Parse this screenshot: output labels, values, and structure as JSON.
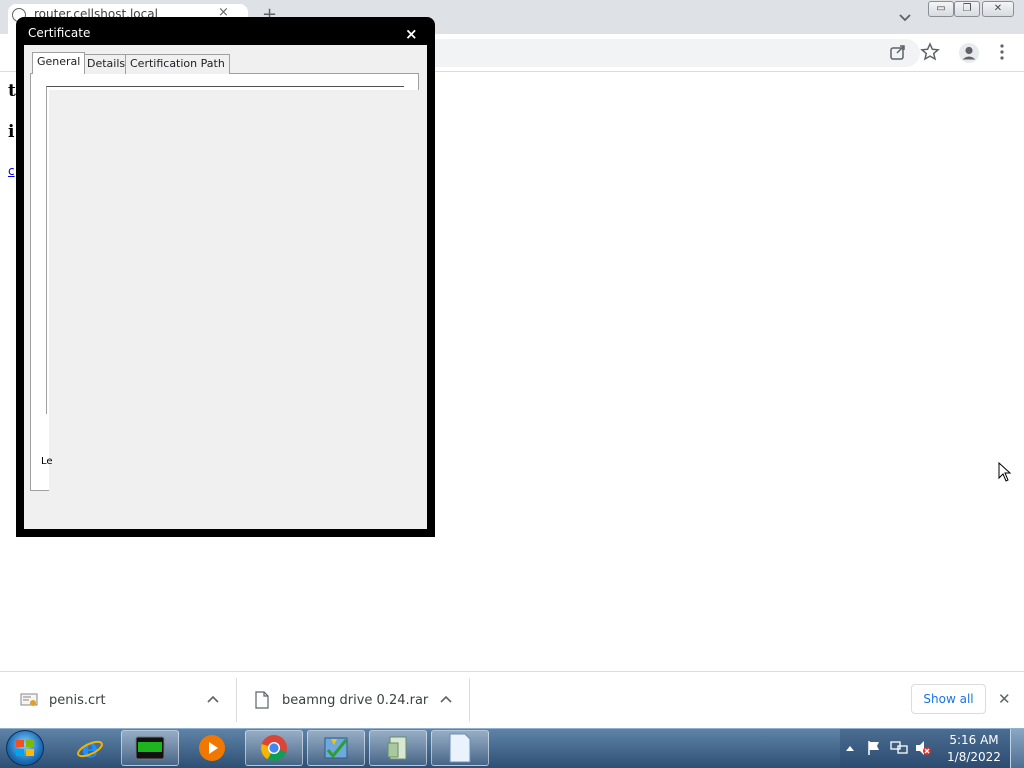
{
  "browser": {
    "tab_title": "router.cellshost.local",
    "tab_close": "×",
    "new_tab": "+",
    "window_buttons": {
      "minimize": "▭",
      "restore": "❐",
      "close": "✕"
    },
    "icons": [
      "share-icon",
      "star-icon",
      "profile-icon",
      "menu-icon"
    ]
  },
  "page": {
    "fragment_1": "tl",
    "fragment_2": "i",
    "link_fragment": "c"
  },
  "cert_dialog": {
    "title": "Certificate",
    "close": "×",
    "tabs": [
      "General",
      "Details",
      "Certification Path"
    ],
    "active_tab": "General",
    "cut_label": "Le"
  },
  "download_shelf": {
    "items": [
      {
        "name": "penis.crt",
        "icon": "certificate-file-icon"
      },
      {
        "name": "beamng drive 0.24.rar",
        "icon": "file-icon"
      }
    ],
    "show_all": "Show all",
    "close": "✕"
  },
  "taskbar": {
    "apps": [
      "internet-explorer",
      "terminal",
      "media-player",
      "chrome",
      "defender",
      "registry",
      "notepad"
    ],
    "clock_time": "5:16 AM",
    "clock_date": "1/8/2022"
  }
}
